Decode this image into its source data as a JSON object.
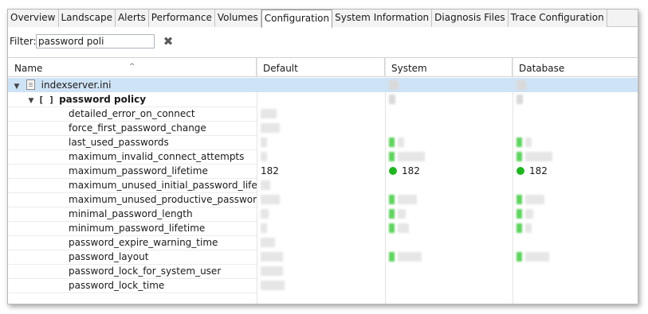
{
  "tabs": [
    {
      "label": "Overview"
    },
    {
      "label": "Landscape"
    },
    {
      "label": "Alerts"
    },
    {
      "label": "Performance"
    },
    {
      "label": "Volumes"
    },
    {
      "label": "Configuration",
      "active": true
    },
    {
      "label": "System Information"
    },
    {
      "label": "Diagnosis Files"
    },
    {
      "label": "Trace Configuration"
    }
  ],
  "filter": {
    "label": "Filter:",
    "value": "password poli"
  },
  "columns": {
    "name": "Name",
    "default": "Default",
    "system": "System",
    "database": "Database"
  },
  "tree": {
    "file": "indexserver.ini",
    "section": "password policy",
    "section_icon": "[ ]"
  },
  "parameters": [
    {
      "name": "detailed_error_on_connect"
    },
    {
      "name": "force_first_password_change"
    },
    {
      "name": "last_used_passwords"
    },
    {
      "name": "maximum_invalid_connect_attempts"
    },
    {
      "name": "maximum_password_lifetime",
      "default": "182",
      "system": "182",
      "database": "182"
    },
    {
      "name": "maximum_unused_initial_password_lifetime"
    },
    {
      "name": "maximum_unused_productive_password_life"
    },
    {
      "name": "minimal_password_length"
    },
    {
      "name": "minimum_password_lifetime"
    },
    {
      "name": "password_expire_warning_time"
    },
    {
      "name": "password_layout"
    },
    {
      "name": "password_lock_for_system_user"
    },
    {
      "name": "password_lock_time"
    }
  ],
  "colors": {
    "selected_row": "#cfe3f6",
    "status_ok": "#1fb51f"
  }
}
